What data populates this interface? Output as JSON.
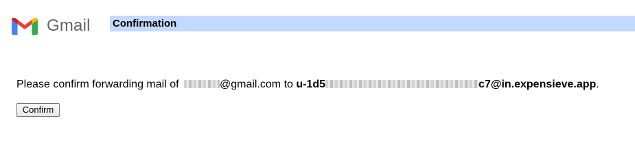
{
  "brand": {
    "name": "Gmail",
    "logo_icon": "gmail-logo-icon",
    "colors": {
      "red": "#ea4335",
      "blue": "#4285f4",
      "green": "#34a853",
      "yellow": "#fbbc04",
      "dark_red": "#c5221f"
    }
  },
  "title_bar": {
    "title": "Confirmation",
    "background": "#c3d9ff"
  },
  "message": {
    "prefix": "Please confirm forwarding mail of ",
    "source_domain": "@gmail.com",
    "middle": " to ",
    "dest_start": "u-1d5",
    "dest_end": "c7@in.expensieve.app",
    "suffix": "."
  },
  "actions": {
    "confirm_label": "Confirm"
  }
}
